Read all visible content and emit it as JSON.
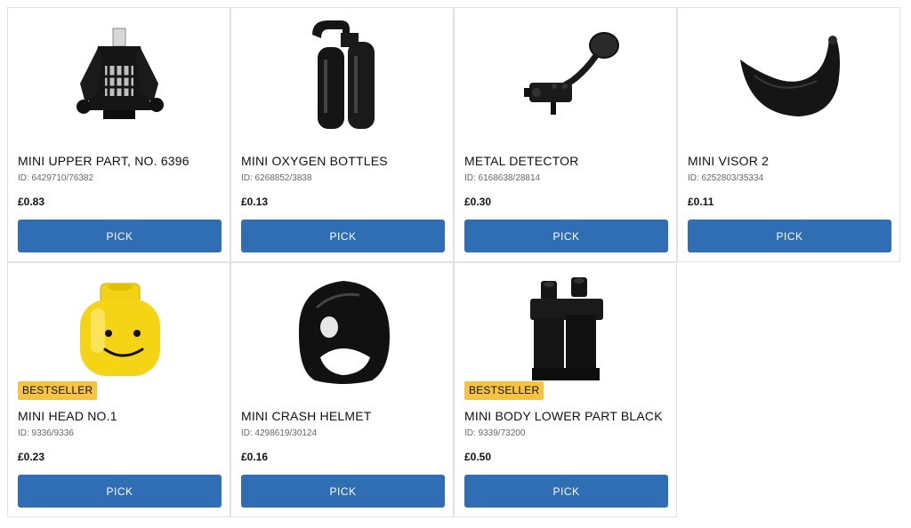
{
  "products": [
    {
      "name": "MINI UPPER PART, NO. 6396",
      "id": "ID: 6429710/76382",
      "price": "£0.83",
      "button": "PICK",
      "badge": "",
      "icon": "torso-icon"
    },
    {
      "name": "MINI OXYGEN BOTTLES",
      "id": "ID: 6268852/3838",
      "price": "£0.13",
      "button": "PICK",
      "badge": "",
      "icon": "oxygen-bottles-icon"
    },
    {
      "name": "METAL DETECTOR",
      "id": "ID: 6168638/28814",
      "price": "£0.30",
      "button": "PICK",
      "badge": "",
      "icon": "metal-detector-icon"
    },
    {
      "name": "MINI VISOR 2",
      "id": "ID: 6252803/35334",
      "price": "£0.11",
      "button": "PICK",
      "badge": "",
      "icon": "visor-icon"
    },
    {
      "name": "MINI HEAD NO.1",
      "id": "ID: 9336/9336",
      "price": "£0.23",
      "button": "PICK",
      "badge": "BESTSELLER",
      "icon": "head-icon"
    },
    {
      "name": "MINI CRASH HELMET",
      "id": "ID: 4298619/30124",
      "price": "£0.16",
      "button": "PICK",
      "badge": "",
      "icon": "helmet-icon"
    },
    {
      "name": "MINI BODY LOWER PART BLACK",
      "id": "ID: 9339/73200",
      "price": "£0.50",
      "button": "PICK",
      "badge": "BESTSELLER",
      "icon": "legs-icon"
    }
  ],
  "colors": {
    "button": "#2f6db4",
    "badge": "#f7c442",
    "part": "#111111",
    "head": "#f5d416"
  }
}
